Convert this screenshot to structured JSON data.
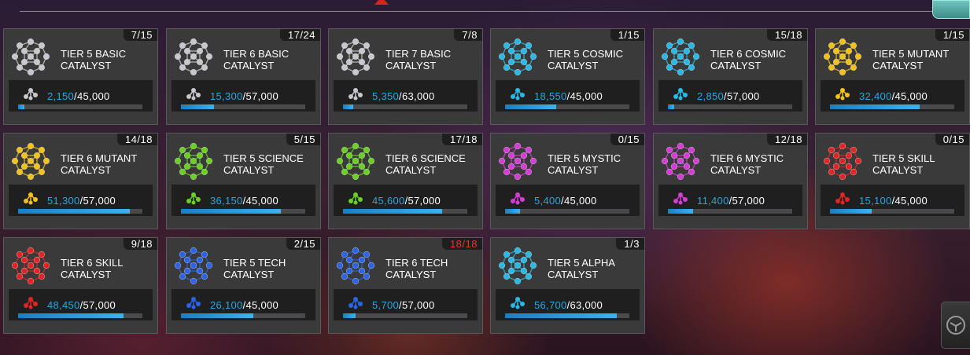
{
  "colors": {
    "progress": "#2aa6df",
    "maxed_count": "#e03a2e",
    "card_bg": "#3a3a3b"
  },
  "header": {
    "alert_icon": "warning-triangle-icon",
    "corner_icon": "chest-icon"
  },
  "footer": {
    "corner_button_icon": "class-filter-icon"
  },
  "catalysts": [
    {
      "count": "7/15",
      "name": "TIER 5 BASIC CATALYST",
      "current": "2,150",
      "max": "45,000",
      "fraction": 0.048,
      "color": "#c8c8cc"
    },
    {
      "count": "17/24",
      "name": "TIER 6 BASIC CATALYST",
      "current": "15,300",
      "max": "57,000",
      "fraction": 0.268,
      "color": "#c8c8cc"
    },
    {
      "count": "7/8",
      "name": "TIER 7 BASIC CATALYST",
      "current": "5,350",
      "max": "63,000",
      "fraction": 0.085,
      "color": "#c8c8cc"
    },
    {
      "count": "1/15",
      "name": "TIER 5 COSMIC CATALYST",
      "current": "18,550",
      "max": "45,000",
      "fraction": 0.412,
      "color": "#29b9e6"
    },
    {
      "count": "15/18",
      "name": "TIER 6 COSMIC CATALYST",
      "current": "2,850",
      "max": "57,000",
      "fraction": 0.05,
      "color": "#29b9e6"
    },
    {
      "count": "1/15",
      "name": "TIER 5 MUTANT CATALYST",
      "current": "32,400",
      "max": "45,000",
      "fraction": 0.72,
      "color": "#f2c21a"
    },
    {
      "count": "14/18",
      "name": "TIER 6 MUTANT CATALYST",
      "current": "51,300",
      "max": "57,000",
      "fraction": 0.9,
      "color": "#f2c21a"
    },
    {
      "count": "5/15",
      "name": "TIER 5 SCIENCE CATALYST",
      "current": "36,150",
      "max": "45,000",
      "fraction": 0.803,
      "color": "#6ad021"
    },
    {
      "count": "17/18",
      "name": "TIER 6 SCIENCE CATALYST",
      "current": "45,600",
      "max": "57,000",
      "fraction": 0.8,
      "color": "#6ad021"
    },
    {
      "count": "0/15",
      "name": "TIER 5 MYSTIC CATALYST",
      "current": "5,400",
      "max": "45,000",
      "fraction": 0.12,
      "color": "#d63cd6"
    },
    {
      "count": "12/18",
      "name": "TIER 6 MYSTIC CATALYST",
      "current": "11,400",
      "max": "57,000",
      "fraction": 0.2,
      "color": "#d63cd6"
    },
    {
      "count": "0/15",
      "name": "TIER 5 SKILL CATALYST",
      "current": "15,100",
      "max": "45,000",
      "fraction": 0.336,
      "color": "#e32424"
    },
    {
      "count": "9/18",
      "name": "TIER 6 SKILL CATALYST",
      "current": "48,450",
      "max": "57,000",
      "fraction": 0.85,
      "color": "#e32424"
    },
    {
      "count": "2/15",
      "name": "TIER 5 TECH CATALYST",
      "current": "26,100",
      "max": "45,000",
      "fraction": 0.58,
      "color": "#2b64e6"
    },
    {
      "count": "18/18",
      "name": "TIER 6 TECH CATALYST",
      "current": "5,700",
      "max": "57,000",
      "fraction": 0.1,
      "color": "#2b64e6",
      "count_maxed": true
    },
    {
      "count": "1/3",
      "name": "TIER 5 ALPHA CATALYST",
      "current": "56,700",
      "max": "63,000",
      "fraction": 0.9,
      "color": "#29b9e6"
    }
  ]
}
